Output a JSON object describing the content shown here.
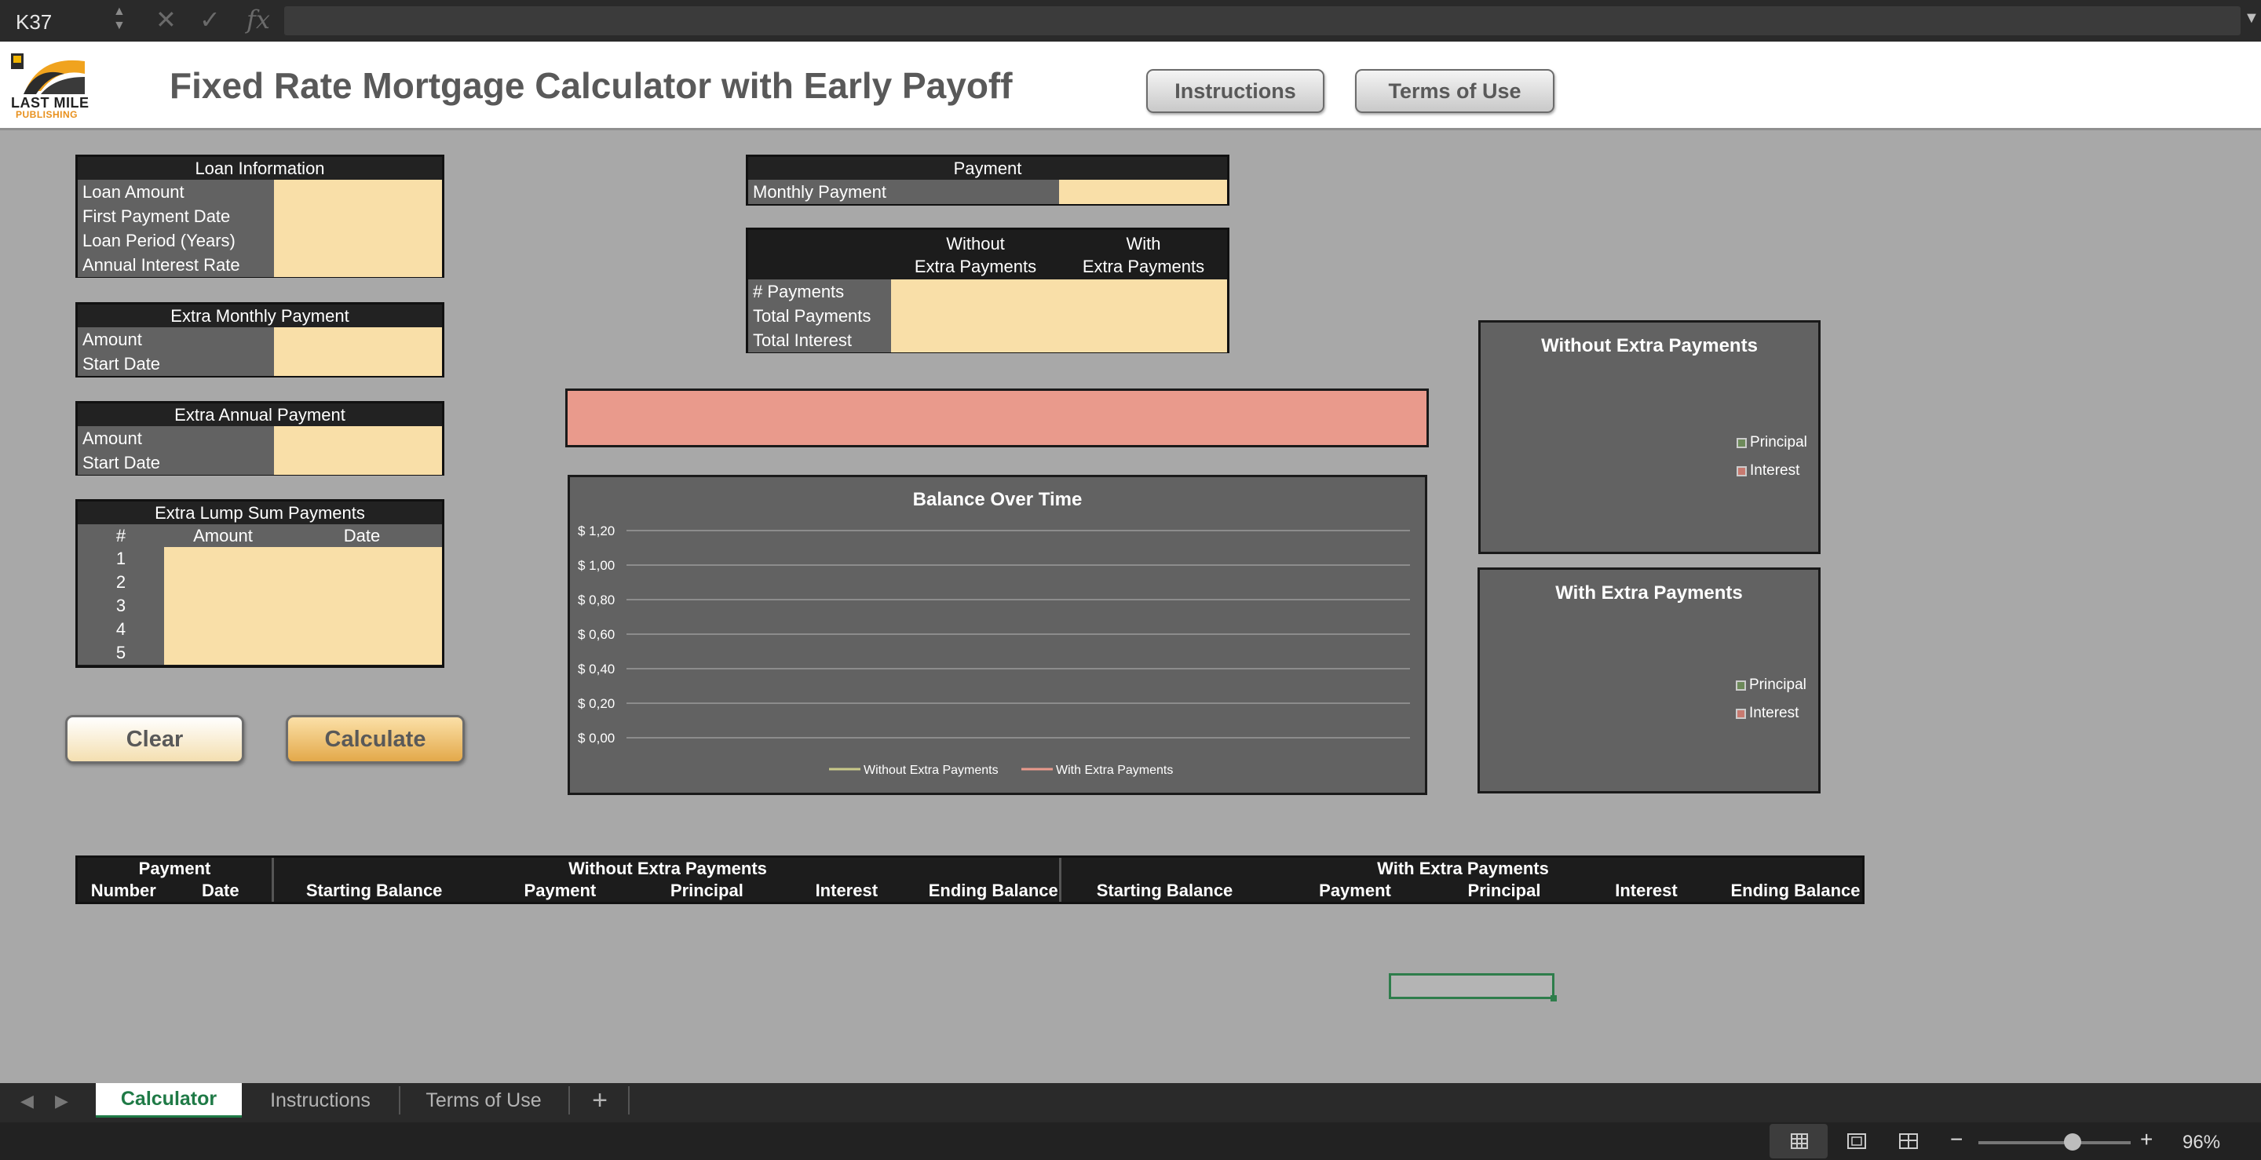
{
  "formula_bar": {
    "cell_ref": "K37",
    "fx_label": "fx"
  },
  "header": {
    "logo_line1": "LAST MILE",
    "logo_line2": "PUBLISHING",
    "title": "Fixed Rate Mortgage Calculator with Early Payoff",
    "instructions_button": "Instructions",
    "terms_button": "Terms of Use"
  },
  "loan_info": {
    "title": "Loan Information",
    "rows": [
      "Loan Amount",
      "First Payment Date",
      "Loan Period (Years)",
      "Annual Interest Rate"
    ]
  },
  "extra_monthly": {
    "title": "Extra Monthly Payment",
    "rows": [
      "Amount",
      "Start Date"
    ]
  },
  "extra_annual": {
    "title": "Extra Annual Payment",
    "rows": [
      "Amount",
      "Start Date"
    ]
  },
  "lump_sum": {
    "title": "Extra Lump Sum Payments",
    "col_num": "#",
    "col_amount": "Amount",
    "col_date": "Date",
    "numbers": [
      "1",
      "2",
      "3",
      "4",
      "5"
    ]
  },
  "payment": {
    "title": "Payment",
    "monthly_label": "Monthly Payment"
  },
  "summary": {
    "without_1": "Without",
    "without_2": "Extra Payments",
    "with_1": "With",
    "with_2": "Extra Payments",
    "rows": [
      "# Payments",
      "Total Payments",
      "Total Interest"
    ]
  },
  "buttons": {
    "clear": "Clear",
    "calculate": "Calculate"
  },
  "chart_data": [
    {
      "type": "line",
      "title": "Balance Over Time",
      "y_ticks": [
        "$ 1,20",
        "$ 1,00",
        "$ 0,80",
        "$ 0,60",
        "$ 0,40",
        "$ 0,20",
        "$ 0,00"
      ],
      "ylim": [
        0,
        1.2
      ],
      "grid": true,
      "legend_position": "bottom",
      "series": [
        {
          "name": "Without Extra Payments",
          "values": [],
          "color": "#c9c98a"
        },
        {
          "name": "With Extra Payments",
          "values": [],
          "color": "#e99a8c"
        }
      ]
    },
    {
      "type": "pie",
      "title": "Without Extra Payments",
      "legend_position": "right",
      "series": [
        {
          "name": "Principal",
          "values": [],
          "color": "#6d8a5a"
        },
        {
          "name": "Interest",
          "values": [],
          "color": "#c77a70"
        }
      ]
    },
    {
      "type": "pie",
      "title": "With Extra Payments",
      "legend_position": "right",
      "series": [
        {
          "name": "Principal",
          "values": [],
          "color": "#6d8a5a"
        },
        {
          "name": "Interest",
          "values": [],
          "color": "#c77a70"
        }
      ]
    }
  ],
  "schedule": {
    "payment_group": "Payment",
    "payment_cols": [
      "Number",
      "Date"
    ],
    "without_group": "Without Extra Payments",
    "with_group": "With Extra Payments",
    "cols": [
      "Starting Balance",
      "Payment",
      "Principal",
      "Interest",
      "Ending Balance"
    ]
  },
  "tabs": [
    "Calculator",
    "Instructions",
    "Terms of Use"
  ],
  "tab_add": "+",
  "status_bar": {
    "zoom": "96%",
    "zoom_fraction": 0.62
  }
}
